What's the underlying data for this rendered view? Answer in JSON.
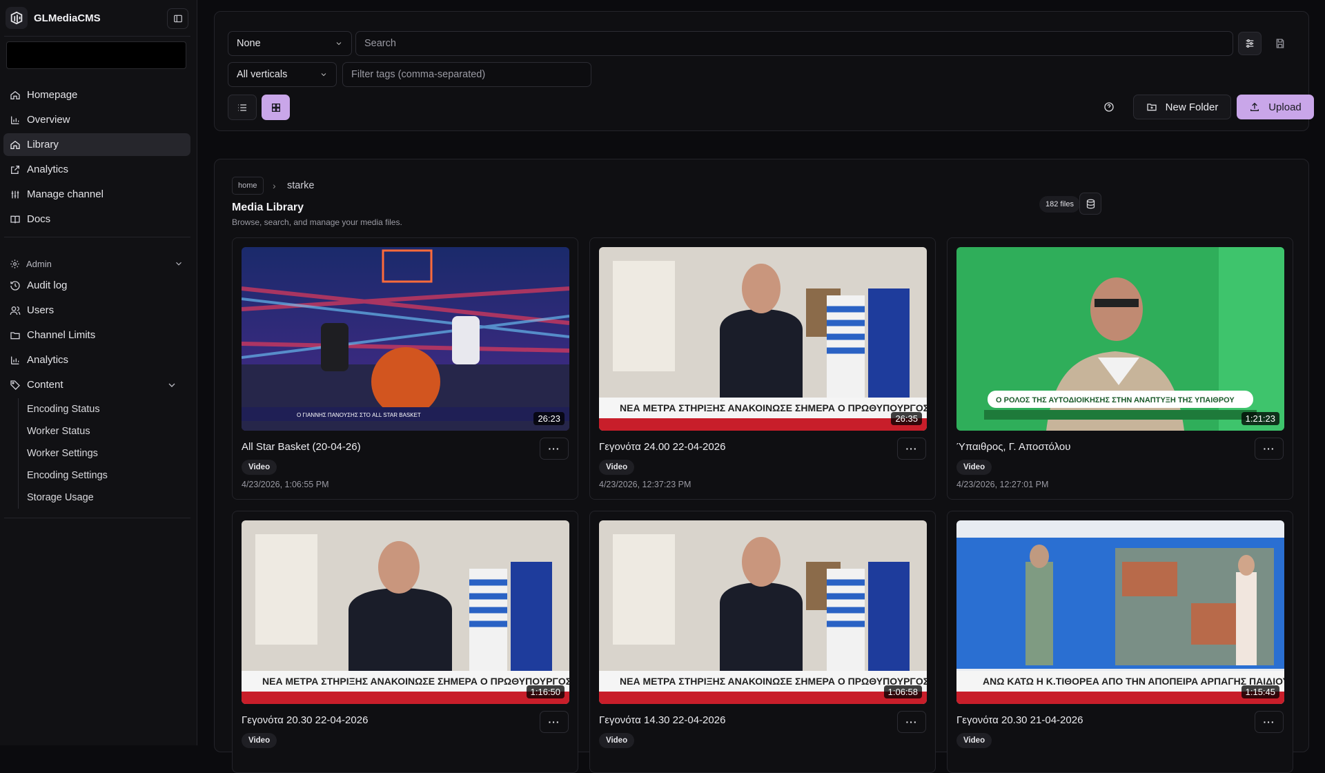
{
  "app": {
    "name": "GLMediaCMS"
  },
  "nav": {
    "main": [
      {
        "label": "Homepage",
        "icon": "home-icon"
      },
      {
        "label": "Overview",
        "icon": "bar-chart-icon"
      },
      {
        "label": "Library",
        "icon": "home-icon",
        "active": true
      },
      {
        "label": "Analytics",
        "icon": "external-link-icon"
      },
      {
        "label": "Manage channel",
        "icon": "sliders-icon"
      },
      {
        "label": "Docs",
        "icon": "book-icon"
      }
    ],
    "admin_label": "Admin",
    "admin": [
      {
        "label": "Audit log",
        "icon": "history-icon"
      },
      {
        "label": "Users",
        "icon": "users-icon"
      },
      {
        "label": "Channel Limits",
        "icon": "folder-icon"
      },
      {
        "label": "Analytics",
        "icon": "bar-chart-icon"
      },
      {
        "label": "Content",
        "icon": "tag-icon"
      }
    ],
    "content_sub": [
      "Encoding Status",
      "Worker Status",
      "Worker Settings",
      "Encoding Settings",
      "Storage Usage"
    ]
  },
  "toolbar": {
    "sort_select": "None",
    "search_placeholder": "Search",
    "verticals_select": "All verticals",
    "tags_placeholder": "Filter tags (comma-separated)",
    "new_folder_label": "New Folder",
    "upload_label": "Upload"
  },
  "library": {
    "breadcrumb_home": "home",
    "breadcrumb_current": "starke",
    "title": "Media Library",
    "subtitle": "Browse, search, and manage your media files.",
    "files_count": "182 files"
  },
  "media": [
    {
      "title": "All Star Basket (20-04-26)",
      "type": "Video",
      "date": "4/23/2026, 1:06:55 PM",
      "duration": "26:23",
      "banner": "Ο ΓΙΑΝΝΗΣ ΠΑΝΟΥΣΗΣ ΣΤΟ ALL STAR BASKET"
    },
    {
      "title": "Γεγονότα 24.00 22-04-2026",
      "type": "Video",
      "date": "4/23/2026, 12:37:23 PM",
      "duration": "26:35",
      "banner": "ΝΕΑ ΜΕΤΡΑ ΣΤΗΡΙΞΗΣ ΑΝΑΚΟΙΝΩΣΕ ΣΗΜΕΡΑ Ο ΠΡΩΘΥΠΟΥΡΓΟΣ"
    },
    {
      "title": "Ύπαιθρος, Γ. Αποστόλου",
      "type": "Video",
      "date": "4/23/2026, 12:27:01 PM",
      "duration": "1:21:23",
      "banner": "Ο ΡΟΛΟΣ ΤΗΣ ΑΥΤΟΔΙΟΙΚΗΣΗΣ ΣΤΗΝ ΑΝΑΠΤΥΞΗ ΤΗΣ ΥΠΑΙΘΡΟΥ"
    },
    {
      "title": "Γεγονότα 20.30 22-04-2026",
      "type": "Video",
      "date": "",
      "duration": "1:16:50",
      "banner": "ΝΕΑ ΜΕΤΡΑ ΣΤΗΡΙΞΗΣ ΑΝΑΚΟΙΝΩΣΕ ΣΗΜΕΡΑ Ο ΠΡΩΘΥΠΟΥΡΓΟΣ"
    },
    {
      "title": "Γεγονότα 14.30 22-04-2026",
      "type": "Video",
      "date": "",
      "duration": "1:06:58",
      "banner": "ΝΕΑ ΜΕΤΡΑ ΣΤΗΡΙΞΗΣ ΑΝΑΚΟΙΝΩΣΕ ΣΗΜΕΡΑ Ο ΠΡΩΘΥΠΟΥΡΓΟΣ"
    },
    {
      "title": "Γεγονότα 20.30 21-04-2026",
      "type": "Video",
      "date": "",
      "duration": "1:15:45",
      "banner": "ΑΝΩ ΚΑΤΩ Η Κ.ΤΙΘΟΡΕΑ ΑΠΟ ΤΗΝ ΑΠΟΠΕΙΡΑ ΑΡΠΑΓΗΣ ΠΑΙΔΙΟΥ"
    }
  ],
  "colors": {
    "accent": "#c9a6e9",
    "background": "#0b0b0e",
    "sidebar": "#111114"
  }
}
